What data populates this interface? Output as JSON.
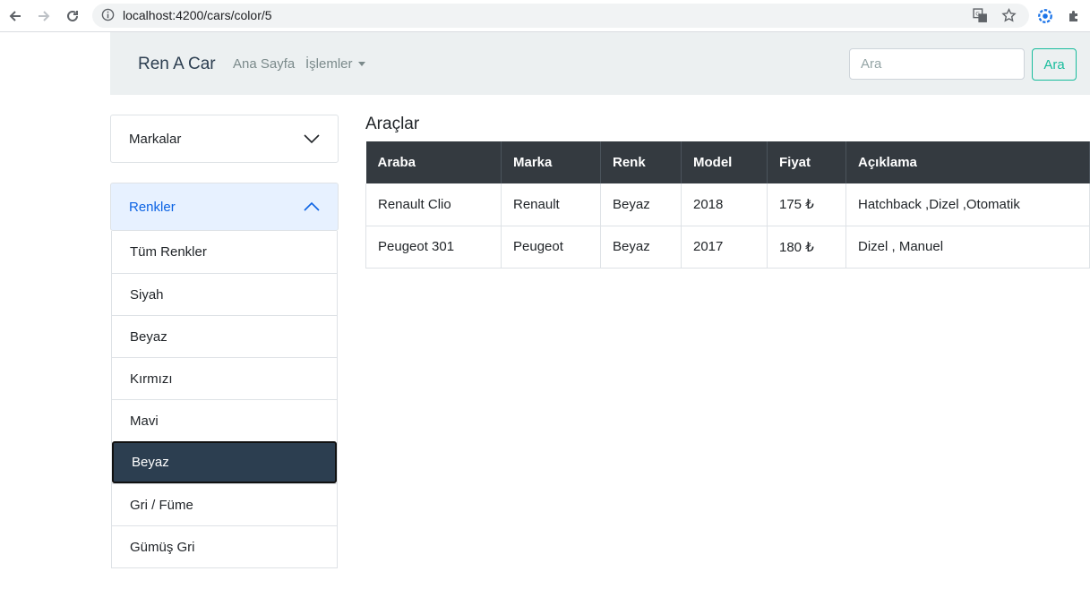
{
  "browser": {
    "url": "localhost:4200/cars/color/5"
  },
  "navbar": {
    "brand": "Ren A Car",
    "links": [
      "Ana Sayfa",
      "İşlemler"
    ],
    "search_placeholder": "Ara",
    "search_button": "Ara"
  },
  "sidebar": {
    "brands_header": "Markalar",
    "colors_header": "Renkler",
    "colors": [
      "Tüm Renkler",
      "Siyah",
      "Beyaz",
      "Kırmızı",
      "Mavi",
      "Beyaz",
      "Gri / Füme",
      "Gümüş Gri"
    ],
    "active_index": 5
  },
  "main": {
    "title": "Araçlar",
    "columns": [
      "Araba",
      "Marka",
      "Renk",
      "Model",
      "Fiyat",
      "Açıklama"
    ],
    "rows": [
      [
        "Renault Clio",
        "Renault",
        "Beyaz",
        "2018",
        "175 ₺",
        "Hatchback ,Dizel ,Otomatik"
      ],
      [
        "Peugeot 301",
        "Peugeot",
        "Beyaz",
        "2017",
        "180 ₺",
        "Dizel , Manuel"
      ]
    ]
  },
  "colors": {
    "navbar_bg": "#ecf0f1",
    "accent": "#18bc9c",
    "active_item": "#2c3e50",
    "table_header": "#343a40"
  }
}
